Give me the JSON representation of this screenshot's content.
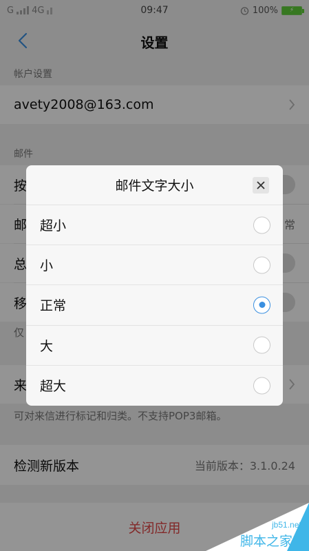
{
  "status_bar": {
    "signal_left": "G",
    "network": "4G",
    "time": "09:47",
    "battery_percent": "100%"
  },
  "nav": {
    "title": "设置"
  },
  "account_section": {
    "header": "帐户设置",
    "email": "avety2008@163.com"
  },
  "mail_section": {
    "header": "邮件",
    "rows": [
      {
        "label": "按"
      },
      {
        "label": "邮",
        "value": "常"
      },
      {
        "label": "总"
      },
      {
        "label": "移"
      }
    ],
    "note_partial": "仅"
  },
  "classify_section": {
    "row_label": "来",
    "note": "可对来信进行标记和归类。不支持POP3邮箱。"
  },
  "update_row": {
    "label": "检测新版本",
    "version": "当前版本：3.1.0.24"
  },
  "close_app_label": "关闭应用",
  "dialog": {
    "title": "邮件文字大小",
    "options": [
      {
        "label": "超小",
        "selected": false
      },
      {
        "label": "小",
        "selected": false
      },
      {
        "label": "正常",
        "selected": true
      },
      {
        "label": "大",
        "selected": false
      },
      {
        "label": "超大",
        "selected": false
      }
    ]
  },
  "watermark": {
    "domain": "jb51.net",
    "brand": "脚本之家"
  },
  "colors": {
    "accent": "#3a8fe0",
    "danger": "#e04848",
    "battery": "#5fcf3a"
  }
}
